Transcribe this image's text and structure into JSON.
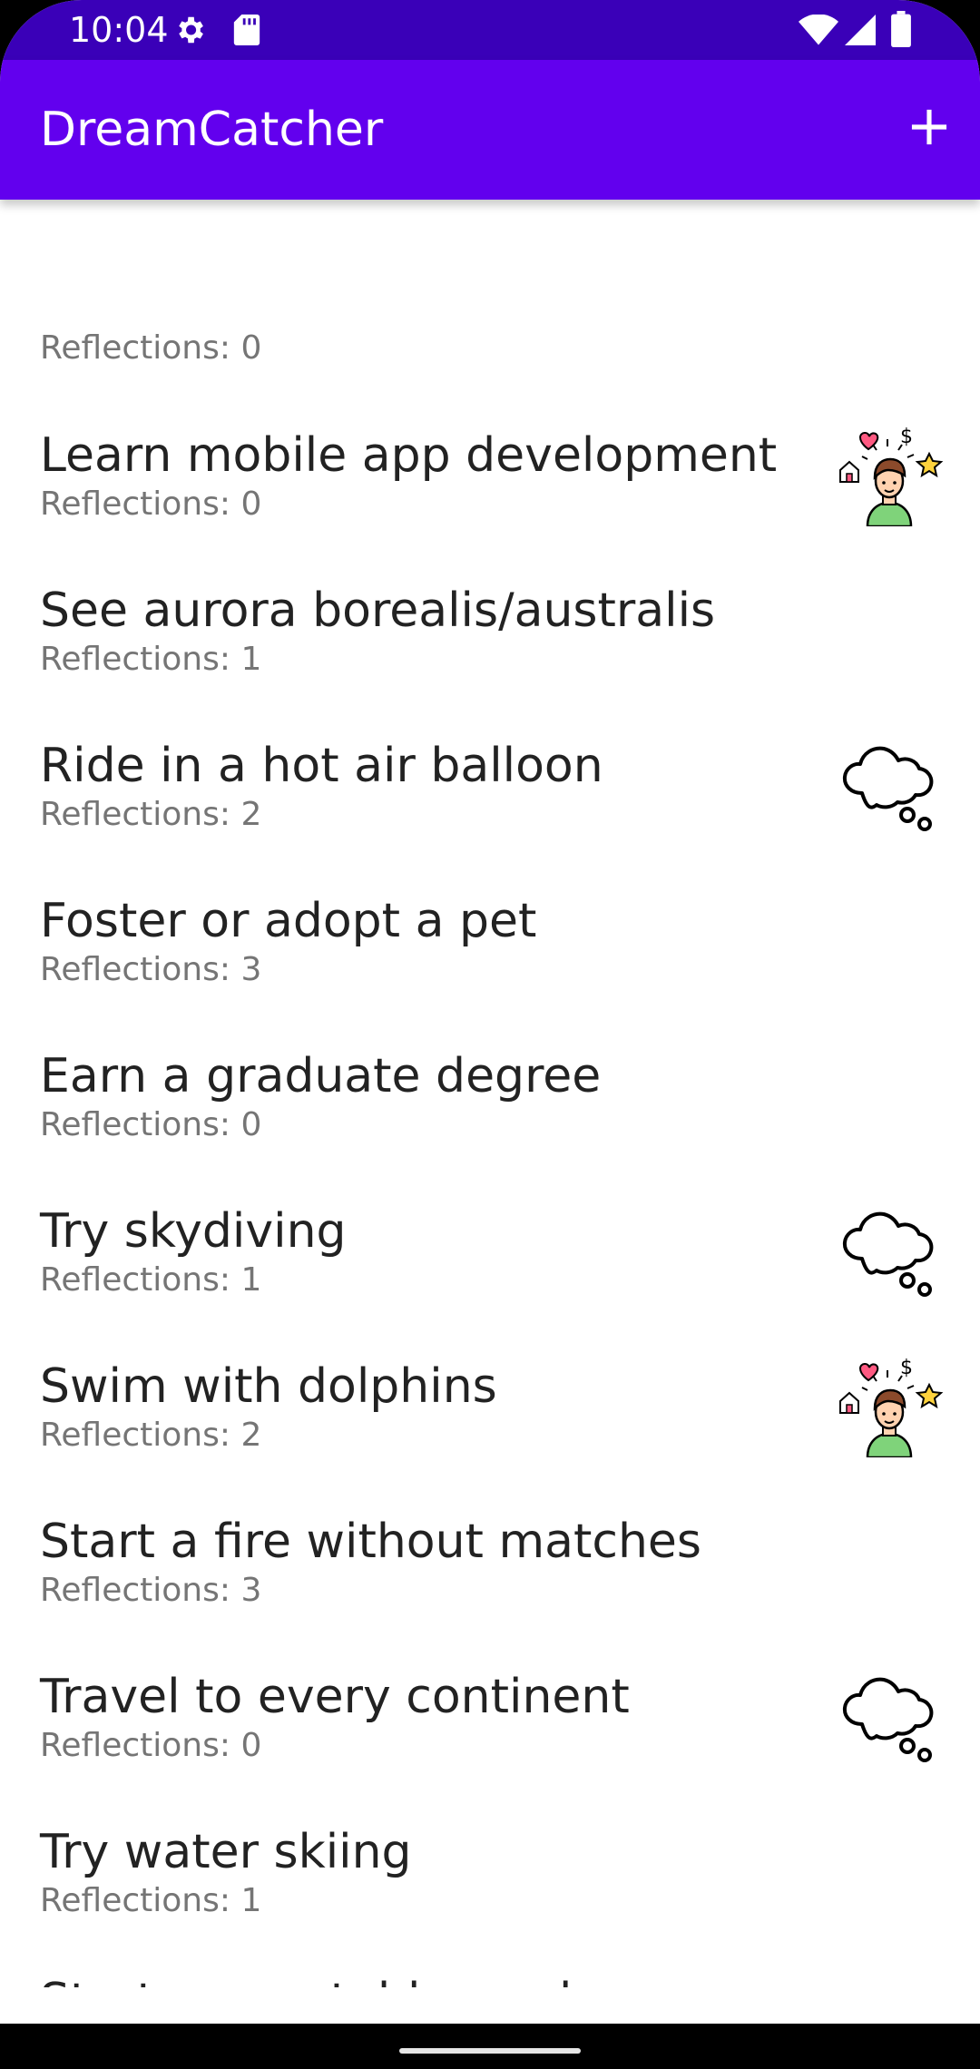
{
  "status": {
    "time": "10:04"
  },
  "app": {
    "title": "DreamCatcher"
  },
  "icons": {
    "status_left": [
      "settings-gear-icon",
      "sd-card-icon"
    ],
    "status_right": [
      "wifi-icon",
      "signal-icon",
      "battery-icon"
    ],
    "add": "plus-icon",
    "thumbnails": [
      "dream-person-icon",
      "thought-cloud-icon"
    ]
  },
  "colors": {
    "appbar": "#6200ee",
    "statusbar": "#3a00b8",
    "title_text": "#222222",
    "subtitle_text": "#757575"
  },
  "list": {
    "top_partial_subtitle": "Reflections: 0",
    "items": [
      {
        "title": "Learn mobile app development",
        "subtitle": "Reflections: 0",
        "icon": "dream-person-icon"
      },
      {
        "title": "See aurora borealis/australis",
        "subtitle": "Reflections: 1",
        "icon": ""
      },
      {
        "title": "Ride in a hot air balloon",
        "subtitle": "Reflections: 2",
        "icon": "thought-cloud-icon"
      },
      {
        "title": "Foster or adopt a pet",
        "subtitle": "Reflections: 3",
        "icon": ""
      },
      {
        "title": "Earn a graduate degree",
        "subtitle": "Reflections: 0",
        "icon": ""
      },
      {
        "title": "Try skydiving",
        "subtitle": "Reflections: 1",
        "icon": "thought-cloud-icon"
      },
      {
        "title": "Swim with dolphins",
        "subtitle": "Reflections: 2",
        "icon": "dream-person-icon"
      },
      {
        "title": "Start a fire without matches",
        "subtitle": "Reflections: 3",
        "icon": ""
      },
      {
        "title": "Travel to every continent",
        "subtitle": "Reflections: 0",
        "icon": "thought-cloud-icon"
      },
      {
        "title": "Try water skiing",
        "subtitle": "Reflections: 1",
        "icon": ""
      }
    ],
    "bottom_partial_title": "Start a vegetable garden"
  }
}
